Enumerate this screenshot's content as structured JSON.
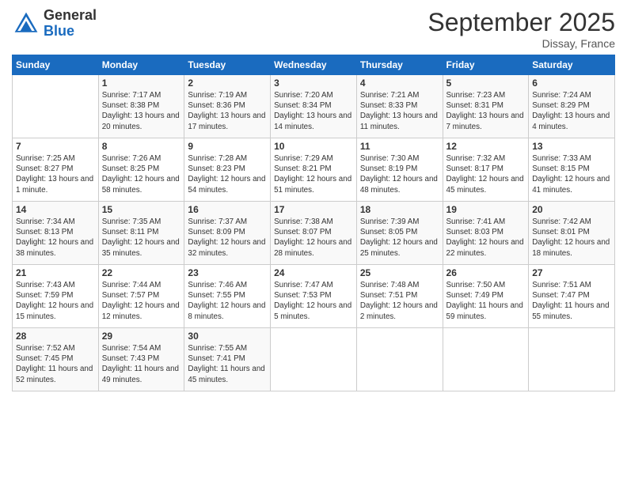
{
  "logo": {
    "general": "General",
    "blue": "Blue"
  },
  "title": "September 2025",
  "location": "Dissay, France",
  "days": [
    "Sunday",
    "Monday",
    "Tuesday",
    "Wednesday",
    "Thursday",
    "Friday",
    "Saturday"
  ],
  "weeks": [
    [
      {
        "day": "",
        "content": ""
      },
      {
        "day": "1",
        "content": "Sunrise: 7:17 AM\nSunset: 8:38 PM\nDaylight: 13 hours\nand 20 minutes."
      },
      {
        "day": "2",
        "content": "Sunrise: 7:19 AM\nSunset: 8:36 PM\nDaylight: 13 hours\nand 17 minutes."
      },
      {
        "day": "3",
        "content": "Sunrise: 7:20 AM\nSunset: 8:34 PM\nDaylight: 13 hours\nand 14 minutes."
      },
      {
        "day": "4",
        "content": "Sunrise: 7:21 AM\nSunset: 8:33 PM\nDaylight: 13 hours\nand 11 minutes."
      },
      {
        "day": "5",
        "content": "Sunrise: 7:23 AM\nSunset: 8:31 PM\nDaylight: 13 hours\nand 7 minutes."
      },
      {
        "day": "6",
        "content": "Sunrise: 7:24 AM\nSunset: 8:29 PM\nDaylight: 13 hours\nand 4 minutes."
      }
    ],
    [
      {
        "day": "7",
        "content": "Sunrise: 7:25 AM\nSunset: 8:27 PM\nDaylight: 13 hours\nand 1 minute."
      },
      {
        "day": "8",
        "content": "Sunrise: 7:26 AM\nSunset: 8:25 PM\nDaylight: 12 hours\nand 58 minutes."
      },
      {
        "day": "9",
        "content": "Sunrise: 7:28 AM\nSunset: 8:23 PM\nDaylight: 12 hours\nand 54 minutes."
      },
      {
        "day": "10",
        "content": "Sunrise: 7:29 AM\nSunset: 8:21 PM\nDaylight: 12 hours\nand 51 minutes."
      },
      {
        "day": "11",
        "content": "Sunrise: 7:30 AM\nSunset: 8:19 PM\nDaylight: 12 hours\nand 48 minutes."
      },
      {
        "day": "12",
        "content": "Sunrise: 7:32 AM\nSunset: 8:17 PM\nDaylight: 12 hours\nand 45 minutes."
      },
      {
        "day": "13",
        "content": "Sunrise: 7:33 AM\nSunset: 8:15 PM\nDaylight: 12 hours\nand 41 minutes."
      }
    ],
    [
      {
        "day": "14",
        "content": "Sunrise: 7:34 AM\nSunset: 8:13 PM\nDaylight: 12 hours\nand 38 minutes."
      },
      {
        "day": "15",
        "content": "Sunrise: 7:35 AM\nSunset: 8:11 PM\nDaylight: 12 hours\nand 35 minutes."
      },
      {
        "day": "16",
        "content": "Sunrise: 7:37 AM\nSunset: 8:09 PM\nDaylight: 12 hours\nand 32 minutes."
      },
      {
        "day": "17",
        "content": "Sunrise: 7:38 AM\nSunset: 8:07 PM\nDaylight: 12 hours\nand 28 minutes."
      },
      {
        "day": "18",
        "content": "Sunrise: 7:39 AM\nSunset: 8:05 PM\nDaylight: 12 hours\nand 25 minutes."
      },
      {
        "day": "19",
        "content": "Sunrise: 7:41 AM\nSunset: 8:03 PM\nDaylight: 12 hours\nand 22 minutes."
      },
      {
        "day": "20",
        "content": "Sunrise: 7:42 AM\nSunset: 8:01 PM\nDaylight: 12 hours\nand 18 minutes."
      }
    ],
    [
      {
        "day": "21",
        "content": "Sunrise: 7:43 AM\nSunset: 7:59 PM\nDaylight: 12 hours\nand 15 minutes."
      },
      {
        "day": "22",
        "content": "Sunrise: 7:44 AM\nSunset: 7:57 PM\nDaylight: 12 hours\nand 12 minutes."
      },
      {
        "day": "23",
        "content": "Sunrise: 7:46 AM\nSunset: 7:55 PM\nDaylight: 12 hours\nand 8 minutes."
      },
      {
        "day": "24",
        "content": "Sunrise: 7:47 AM\nSunset: 7:53 PM\nDaylight: 12 hours\nand 5 minutes."
      },
      {
        "day": "25",
        "content": "Sunrise: 7:48 AM\nSunset: 7:51 PM\nDaylight: 12 hours\nand 2 minutes."
      },
      {
        "day": "26",
        "content": "Sunrise: 7:50 AM\nSunset: 7:49 PM\nDaylight: 11 hours\nand 59 minutes."
      },
      {
        "day": "27",
        "content": "Sunrise: 7:51 AM\nSunset: 7:47 PM\nDaylight: 11 hours\nand 55 minutes."
      }
    ],
    [
      {
        "day": "28",
        "content": "Sunrise: 7:52 AM\nSunset: 7:45 PM\nDaylight: 11 hours\nand 52 minutes."
      },
      {
        "day": "29",
        "content": "Sunrise: 7:54 AM\nSunset: 7:43 PM\nDaylight: 11 hours\nand 49 minutes."
      },
      {
        "day": "30",
        "content": "Sunrise: 7:55 AM\nSunset: 7:41 PM\nDaylight: 11 hours\nand 45 minutes."
      },
      {
        "day": "",
        "content": ""
      },
      {
        "day": "",
        "content": ""
      },
      {
        "day": "",
        "content": ""
      },
      {
        "day": "",
        "content": ""
      }
    ]
  ]
}
